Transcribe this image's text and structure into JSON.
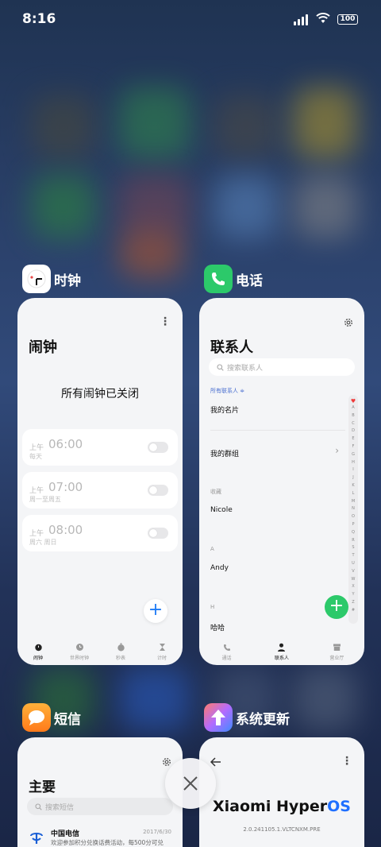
{
  "status": {
    "time": "8:16",
    "battery": "100"
  },
  "cards": {
    "clock": {
      "app_name": "时钟",
      "title": "闹钟",
      "empty_text": "所有闹钟已关闭",
      "alarms": [
        {
          "ampm": "上午",
          "time": "06:00",
          "days": "每天"
        },
        {
          "ampm": "上午",
          "time": "07:00",
          "days": "周一至周五"
        },
        {
          "ampm": "上午",
          "time": "08:00",
          "days": "周六 周日"
        }
      ],
      "add_label": "+",
      "nav": [
        "闹钟",
        "世界时钟",
        "秒表",
        "计时"
      ]
    },
    "phone": {
      "app_name": "电话",
      "title": "联系人",
      "search_placeholder": "搜索联系人",
      "filter": "所有联系人 ≑",
      "my_card": "我的名片",
      "my_groups": "我的群组",
      "favorites_header": "收藏",
      "sections": [
        {
          "header": "A",
          "name": "Andy"
        },
        {
          "header": "H",
          "name": "哈哈"
        }
      ],
      "favorite": "Nicole",
      "alphabet": [
        "♥",
        "A",
        "B",
        "C",
        "D",
        "E",
        "F",
        "G",
        "H",
        "I",
        "J",
        "K",
        "L",
        "M",
        "N",
        "O",
        "P",
        "Q",
        "R",
        "S",
        "T",
        "U",
        "V",
        "W",
        "X",
        "Y",
        "Z",
        "#"
      ],
      "nav": [
        "通话",
        "联系人",
        "营业厅"
      ],
      "add_label": "+"
    },
    "messages": {
      "app_name": "短信",
      "title": "主要",
      "search_placeholder": "搜索短信",
      "message": {
        "sender": "中国电信",
        "date": "2017/6/30",
        "preview": "欢迎参加积分兑换话费活动，每500分可兑"
      }
    },
    "update": {
      "app_name": "系统更新",
      "brand": "Xiaomi Hyper",
      "brand_os": "OS",
      "version": "2.0.241105.1.VLTCNXM.PRE"
    }
  },
  "colors": {
    "accent_blue": "#1e7bf5",
    "phone_green": "#2cc96a",
    "heart_red": "#ef3b3b"
  }
}
